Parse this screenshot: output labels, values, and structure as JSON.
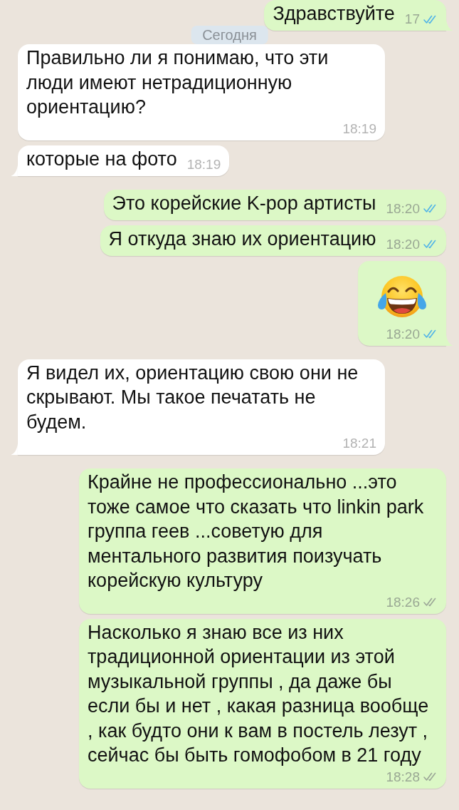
{
  "date_chip": {
    "label": "Сегодня"
  },
  "messages": [
    {
      "outgoing": true,
      "kind": "text",
      "text": "Здравствуйте",
      "time": "17",
      "read": true,
      "tail": true
    },
    {
      "outgoing": false,
      "kind": "text",
      "text": "Правильно ли я понимаю, что эти люди имеют нетрадиционную ориентацию?",
      "time": "18:19",
      "tail": false
    },
    {
      "outgoing": false,
      "kind": "text",
      "text": "которые на фото",
      "time": "18:19",
      "tail": true
    },
    {
      "outgoing": true,
      "kind": "text",
      "text": "Это корейские K-pop артисты",
      "time": "18:20",
      "read": true,
      "tail": false
    },
    {
      "outgoing": true,
      "kind": "text",
      "text": "Я откуда знаю их ориентацию",
      "time": "18:20",
      "read": true,
      "tail": false
    },
    {
      "outgoing": true,
      "kind": "emoji",
      "time": "18:20",
      "read": true,
      "tail": true
    },
    {
      "outgoing": false,
      "kind": "text",
      "text": "Я видел их, ориентацию свою они не скрывают. Мы такое печатать не будем.",
      "time": "18:21",
      "tail": true
    },
    {
      "outgoing": true,
      "kind": "text",
      "text": "Крайне не профессионально ...это тоже самое что сказать что linkin park группа геев ...советую для ментального развития поизучать корейскую культуру",
      "time": "18:26",
      "read": false,
      "tail": false
    },
    {
      "outgoing": true,
      "kind": "text",
      "text": "Насколько я знаю все из них традиционной ориентации из этой музыкальной группы , да даже бы если бы и нет , какая разница вообще , как будто они к вам в постель лезут , сейчас бы быть гомофобом в 21 году",
      "time": "18:28",
      "read": false,
      "tail": false
    }
  ]
}
